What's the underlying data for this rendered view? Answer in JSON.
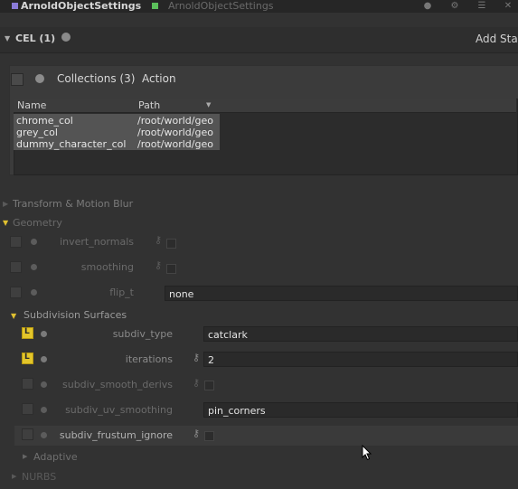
{
  "header": {
    "node_name": "ArnoldObjectSettings",
    "node_type": "ArnoldObjectSettings",
    "colors": {
      "badge": "#8a7bd8",
      "square": "#5bbf5b"
    },
    "icons": [
      "circle-icon",
      "gear-icon",
      "list-icon",
      "close-icon"
    ]
  },
  "cel": {
    "label": "CEL (1)",
    "add_label": "Add Sta"
  },
  "collections": {
    "label": "Collections (3)",
    "action_label": "Action",
    "columns": {
      "name": "Name",
      "path": "Path"
    },
    "rows": [
      {
        "name": "chrome_col",
        "path": "/root/world/geo"
      },
      {
        "name": "grey_col",
        "path": "/root/world/geo"
      },
      {
        "name": "dummy_character_col",
        "path": "/root/world/geo"
      }
    ]
  },
  "sections": {
    "transform": "Transform & Motion Blur",
    "geometry": "Geometry",
    "subdivision": "Subdivision Surfaces",
    "adaptive": "Adaptive",
    "nurbs": "NURBS"
  },
  "params": {
    "invert_normals": {
      "label": "invert_normals"
    },
    "smoothing": {
      "label": "smoothing"
    },
    "flip_t": {
      "label": "flip_t",
      "value": "none"
    },
    "subdiv_type": {
      "label": "subdiv_type",
      "value": "catclark"
    },
    "iterations": {
      "label": "iterations",
      "value": "2"
    },
    "subdiv_smooth_derivs": {
      "label": "subdiv_smooth_derivs"
    },
    "subdiv_uv_smoothing": {
      "label": "subdiv_uv_smoothing",
      "value": "pin_corners"
    },
    "subdiv_frustum_ignore": {
      "label": "subdiv_frustum_ignore"
    }
  },
  "accent_color": "#e3c52a"
}
